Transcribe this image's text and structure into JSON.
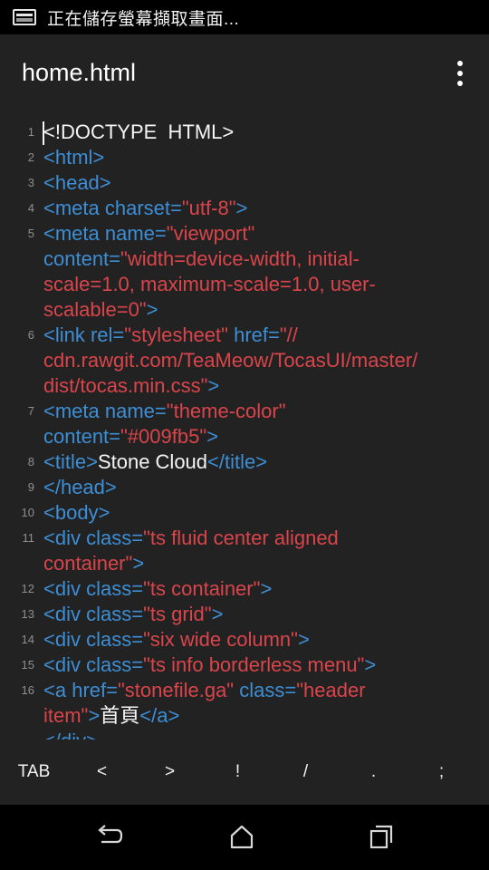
{
  "status_bar": {
    "text": "正在儲存螢幕擷取畫面..."
  },
  "app_bar": {
    "title": "home.html"
  },
  "editor": {
    "lines": [
      {
        "n": "1",
        "segs": [
          {
            "c": "txt",
            "t": "<!DOCTYPE  HTML>"
          }
        ]
      },
      {
        "n": "2",
        "segs": [
          {
            "c": "tag",
            "t": "<html>"
          }
        ]
      },
      {
        "n": "3",
        "segs": [
          {
            "c": "tag",
            "t": "<head>"
          }
        ]
      },
      {
        "n": "4",
        "segs": [
          {
            "c": "tag",
            "t": "<meta "
          },
          {
            "c": "attr",
            "t": "charset="
          },
          {
            "c": "str",
            "t": "\"utf-8\""
          },
          {
            "c": "tag",
            "t": ">"
          }
        ]
      },
      {
        "n": "5",
        "segs": [
          {
            "c": "tag",
            "t": "<meta "
          },
          {
            "c": "attr",
            "t": "name="
          },
          {
            "c": "str",
            "t": "\"viewport\""
          },
          {
            "c": "tag",
            "t": "\n"
          },
          {
            "c": "attr",
            "t": "content="
          },
          {
            "c": "str",
            "t": "\"width=device-width, initial-\nscale=1.0, maximum-scale=1.0, user-\nscalable=0\""
          },
          {
            "c": "tag",
            "t": ">"
          }
        ]
      },
      {
        "n": "6",
        "segs": [
          {
            "c": "tag",
            "t": "<link "
          },
          {
            "c": "attr",
            "t": "rel="
          },
          {
            "c": "str",
            "t": "\"stylesheet\""
          },
          {
            "c": "tag",
            "t": " "
          },
          {
            "c": "attr",
            "t": "href="
          },
          {
            "c": "str",
            "t": "\"//\ncdn.rawgit.com/TeaMeow/TocasUI/master/\ndist/tocas.min.css\""
          },
          {
            "c": "tag",
            "t": ">"
          }
        ]
      },
      {
        "n": "7",
        "segs": [
          {
            "c": "tag",
            "t": "<meta "
          },
          {
            "c": "attr",
            "t": "name="
          },
          {
            "c": "str",
            "t": "\"theme-color\""
          },
          {
            "c": "tag",
            "t": "\n"
          },
          {
            "c": "attr",
            "t": "content="
          },
          {
            "c": "str",
            "t": "\"#009fb5\""
          },
          {
            "c": "tag",
            "t": ">"
          }
        ]
      },
      {
        "n": "8",
        "segs": [
          {
            "c": "tag",
            "t": "<title>"
          },
          {
            "c": "txt",
            "t": "Stone Cloud"
          },
          {
            "c": "tag",
            "t": "</title>"
          }
        ]
      },
      {
        "n": "9",
        "segs": [
          {
            "c": "tag",
            "t": "</head>"
          }
        ]
      },
      {
        "n": "10",
        "segs": [
          {
            "c": "tag",
            "t": "<body>"
          }
        ]
      },
      {
        "n": "11",
        "segs": [
          {
            "c": "tag",
            "t": "<div "
          },
          {
            "c": "attr",
            "t": "class="
          },
          {
            "c": "str",
            "t": "\"ts fluid center aligned\ncontainer\""
          },
          {
            "c": "tag",
            "t": ">"
          }
        ]
      },
      {
        "n": "12",
        "segs": [
          {
            "c": "tag",
            "t": "<div "
          },
          {
            "c": "attr",
            "t": "class="
          },
          {
            "c": "str",
            "t": "\"ts container\""
          },
          {
            "c": "tag",
            "t": ">"
          }
        ]
      },
      {
        "n": "13",
        "segs": [
          {
            "c": "tag",
            "t": "<div "
          },
          {
            "c": "attr",
            "t": "class="
          },
          {
            "c": "str",
            "t": "\"ts grid\""
          },
          {
            "c": "tag",
            "t": ">"
          }
        ]
      },
      {
        "n": "14",
        "segs": [
          {
            "c": "tag",
            "t": "<div "
          },
          {
            "c": "attr",
            "t": "class="
          },
          {
            "c": "str",
            "t": "\"six wide column\""
          },
          {
            "c": "tag",
            "t": ">"
          }
        ]
      },
      {
        "n": "15",
        "segs": [
          {
            "c": "tag",
            "t": "<div "
          },
          {
            "c": "attr",
            "t": "class="
          },
          {
            "c": "str",
            "t": "\"ts info borderless menu\""
          },
          {
            "c": "tag",
            "t": ">"
          }
        ]
      },
      {
        "n": "16",
        "segs": [
          {
            "c": "tag",
            "t": "<a "
          },
          {
            "c": "attr",
            "t": "href="
          },
          {
            "c": "str",
            "t": "\"stonefile.ga\""
          },
          {
            "c": "tag",
            "t": " "
          },
          {
            "c": "attr",
            "t": "class="
          },
          {
            "c": "str",
            "t": "\"header\nitem\""
          },
          {
            "c": "tag",
            "t": ">"
          },
          {
            "c": "txt",
            "t": "首頁"
          },
          {
            "c": "tag",
            "t": "</a>"
          }
        ]
      },
      {
        "n": "",
        "segs": [
          {
            "c": "tag",
            "t": "</div>"
          }
        ]
      }
    ]
  },
  "keybar": {
    "keys": [
      {
        "label": "TAB",
        "name": "key-tab"
      },
      {
        "label": "<",
        "name": "key-less-than"
      },
      {
        "label": ">",
        "name": "key-greater-than"
      },
      {
        "label": "!",
        "name": "key-exclamation"
      },
      {
        "label": "/",
        "name": "key-slash"
      },
      {
        "label": ".",
        "name": "key-period"
      },
      {
        "label": ";",
        "name": "key-semicolon"
      }
    ]
  },
  "colors": {
    "tag": "#3d8ed4",
    "string": "#d9454b",
    "text": "#f5f5f5",
    "background": "#222222"
  },
  "icons": {
    "status": "screenshot-icon",
    "menu": "more-vert-icon",
    "nav": [
      "back-icon",
      "home-icon",
      "recents-icon"
    ]
  }
}
